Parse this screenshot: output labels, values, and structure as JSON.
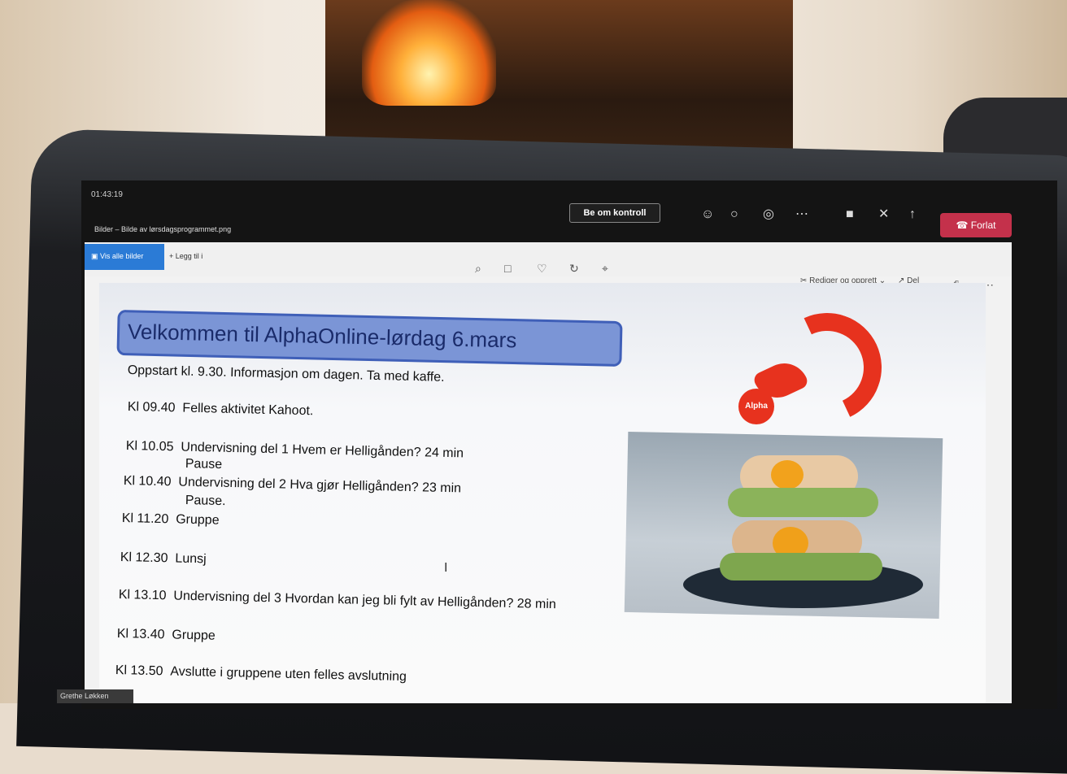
{
  "meeting": {
    "timer": "01:43:19",
    "file_title": "Bilder – Bilde av lørsdagsprogrammet.png",
    "request_control": "Be om kontroll",
    "leave": "Forlat",
    "participant": "Grethe Løkken"
  },
  "photos_app": {
    "view_all": "Vis alle bilder",
    "add_to": "Legg til i",
    "edit_create": "Rediger og opprett",
    "share": "Del"
  },
  "slide": {
    "title": "Velkommen til AlphaOnline-lørdag 6.mars",
    "start_line": "Oppstart kl. 9.30. Informasjon om dagen. Ta med kaffe.",
    "items": [
      {
        "time": "Kl 09.40",
        "text": "Felles aktivitet Kahoot."
      },
      {
        "time": "Kl 10.05",
        "text": "Undervisning del 1 Hvem er Helligånden?  24 min"
      },
      {
        "time": "",
        "text": "Pause"
      },
      {
        "time": "Kl 10.40",
        "text": "Undervisning del 2 Hva gjør Helligånden?  23 min"
      },
      {
        "time": "",
        "text": "Pause."
      },
      {
        "time": "Kl 11.20",
        "text": "Gruppe"
      },
      {
        "time": "Kl  12.30",
        "text": "Lunsj"
      },
      {
        "time": "Kl  13.10",
        "text": "Undervisning del 3 Hvordan kan jeg bli fylt av Helligånden? 28 min"
      },
      {
        "time": "Kl  13.40",
        "text": "Gruppe"
      },
      {
        "time": "Kl 13.50",
        "text": "Avslutte i gruppene uten felles avslutning"
      }
    ],
    "logo_text": "Alpha"
  }
}
